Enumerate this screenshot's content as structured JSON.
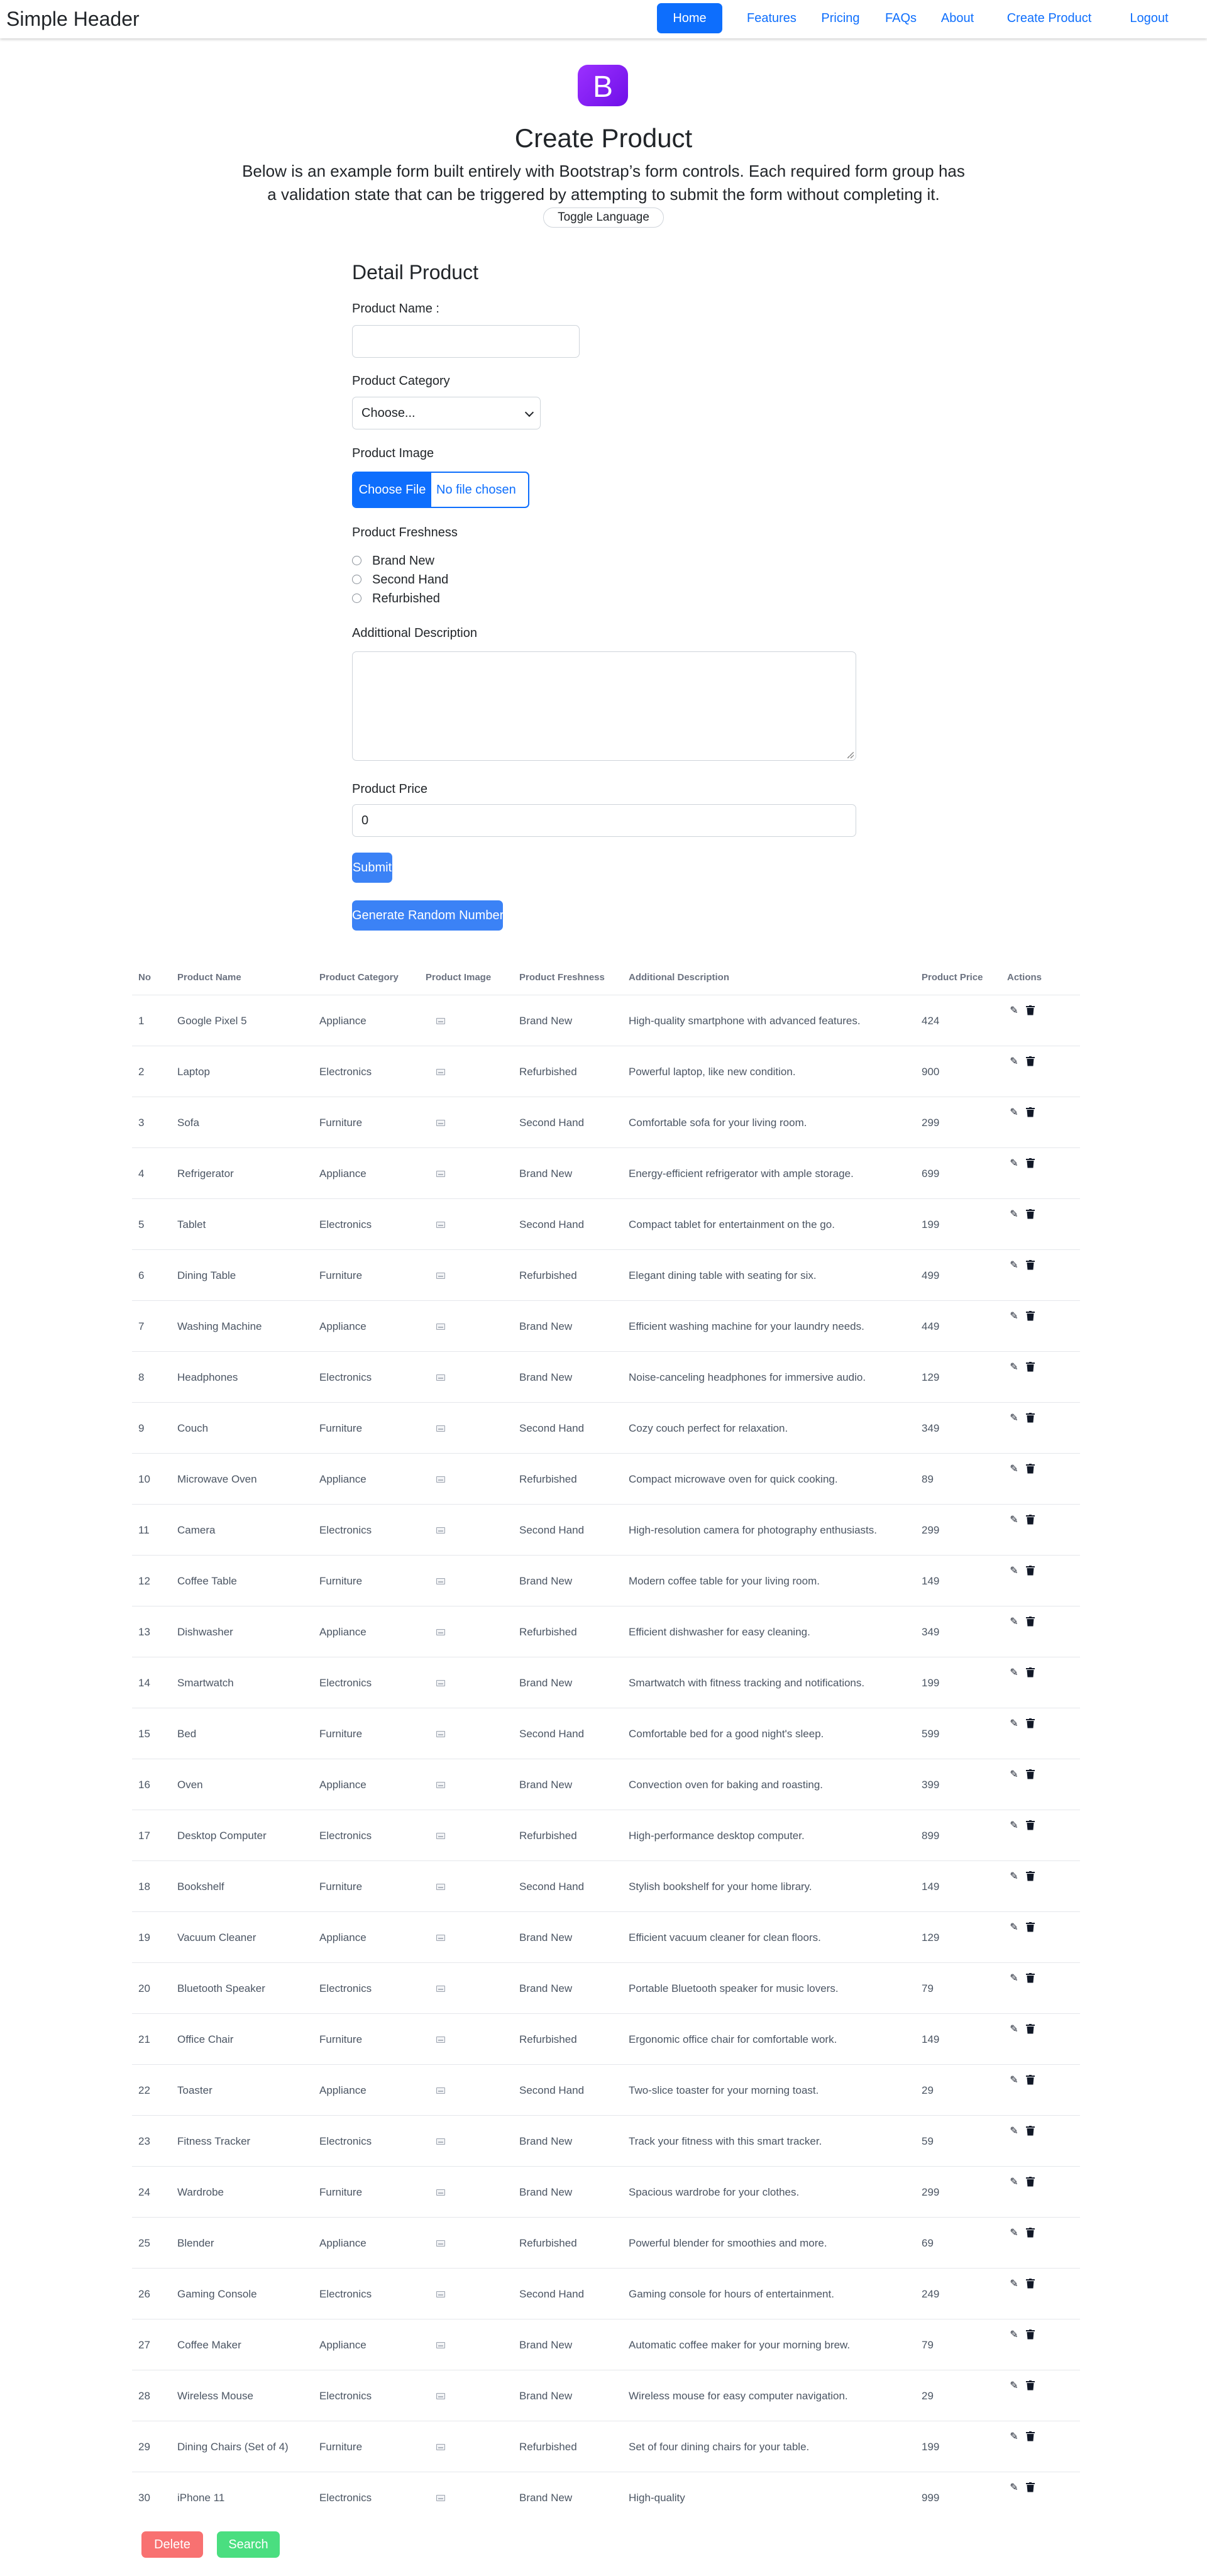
{
  "header": {
    "brand": "Simple Header",
    "nav": [
      "Home",
      "Features",
      "Pricing",
      "FAQs",
      "About",
      "Create Product",
      "Logout"
    ],
    "active": "Home"
  },
  "hero": {
    "logo_letter": "B",
    "title": "Create Product",
    "lead": "Below is an example form built entirely with Bootstrap’s form controls. Each required form group has a validation state that can be triggered by attempting to submit the form without completing it.",
    "toggle_label": "Toggle Language"
  },
  "form": {
    "title": "Detail Product",
    "name_label": "Product Name :",
    "name_value": "",
    "category_label": "Product Category",
    "category_selected": "Choose...",
    "image_label": "Product Image",
    "file_button": "Choose File",
    "file_status": "No file chosen",
    "freshness_label": "Product Freshness",
    "freshness_options": [
      "Brand New",
      "Second Hand",
      "Refurbished"
    ],
    "description_label": "Addittional Description",
    "price_label": "Product Price",
    "price_value": "0",
    "submit_label": "Submit",
    "random_label": "Generate Random Number"
  },
  "table": {
    "headers": [
      "No",
      "Product Name",
      "Product Category",
      "Product Image",
      "Product Freshness",
      "Additional Description",
      "Product Price",
      "Actions"
    ],
    "rows": [
      [
        "1",
        "Google Pixel 5",
        "Appliance",
        "Brand New",
        "High-quality smartphone with advanced features.",
        "424"
      ],
      [
        "2",
        "Laptop",
        "Electronics",
        "Refurbished",
        "Powerful laptop, like new condition.",
        "900"
      ],
      [
        "3",
        "Sofa",
        "Furniture",
        "Second Hand",
        "Comfortable sofa for your living room.",
        "299"
      ],
      [
        "4",
        "Refrigerator",
        "Appliance",
        "Brand New",
        "Energy-efficient refrigerator with ample storage.",
        "699"
      ],
      [
        "5",
        "Tablet",
        "Electronics",
        "Second Hand",
        "Compact tablet for entertainment on the go.",
        "199"
      ],
      [
        "6",
        "Dining Table",
        "Furniture",
        "Refurbished",
        "Elegant dining table with seating for six.",
        "499"
      ],
      [
        "7",
        "Washing Machine",
        "Appliance",
        "Brand New",
        "Efficient washing machine for your laundry needs.",
        "449"
      ],
      [
        "8",
        "Headphones",
        "Electronics",
        "Brand New",
        "Noise-canceling headphones for immersive audio.",
        "129"
      ],
      [
        "9",
        "Couch",
        "Furniture",
        "Second Hand",
        "Cozy couch perfect for relaxation.",
        "349"
      ],
      [
        "10",
        "Microwave Oven",
        "Appliance",
        "Refurbished",
        "Compact microwave oven for quick cooking.",
        "89"
      ],
      [
        "11",
        "Camera",
        "Electronics",
        "Second Hand",
        "High-resolution camera for photography enthusiasts.",
        "299"
      ],
      [
        "12",
        "Coffee Table",
        "Furniture",
        "Brand New",
        "Modern coffee table for your living room.",
        "149"
      ],
      [
        "13",
        "Dishwasher",
        "Appliance",
        "Refurbished",
        "Efficient dishwasher for easy cleaning.",
        "349"
      ],
      [
        "14",
        "Smartwatch",
        "Electronics",
        "Brand New",
        "Smartwatch with fitness tracking and notifications.",
        "199"
      ],
      [
        "15",
        "Bed",
        "Furniture",
        "Second Hand",
        "Comfortable bed for a good night's sleep.",
        "599"
      ],
      [
        "16",
        "Oven",
        "Appliance",
        "Brand New",
        "Convection oven for baking and roasting.",
        "399"
      ],
      [
        "17",
        "Desktop Computer",
        "Electronics",
        "Refurbished",
        "High-performance desktop computer.",
        "899"
      ],
      [
        "18",
        "Bookshelf",
        "Furniture",
        "Second Hand",
        "Stylish bookshelf for your home library.",
        "149"
      ],
      [
        "19",
        "Vacuum Cleaner",
        "Appliance",
        "Brand New",
        "Efficient vacuum cleaner for clean floors.",
        "129"
      ],
      [
        "20",
        "Bluetooth Speaker",
        "Electronics",
        "Brand New",
        "Portable Bluetooth speaker for music lovers.",
        "79"
      ],
      [
        "21",
        "Office Chair",
        "Furniture",
        "Refurbished",
        "Ergonomic office chair for comfortable work.",
        "149"
      ],
      [
        "22",
        "Toaster",
        "Appliance",
        "Second Hand",
        "Two-slice toaster for your morning toast.",
        "29"
      ],
      [
        "23",
        "Fitness Tracker",
        "Electronics",
        "Brand New",
        "Track your fitness with this smart tracker.",
        "59"
      ],
      [
        "24",
        "Wardrobe",
        "Furniture",
        "Brand New",
        "Spacious wardrobe for your clothes.",
        "299"
      ],
      [
        "25",
        "Blender",
        "Appliance",
        "Refurbished",
        "Powerful blender for smoothies and more.",
        "69"
      ],
      [
        "26",
        "Gaming Console",
        "Electronics",
        "Second Hand",
        "Gaming console for hours of entertainment.",
        "249"
      ],
      [
        "27",
        "Coffee Maker",
        "Appliance",
        "Brand New",
        "Automatic coffee maker for your morning brew.",
        "79"
      ],
      [
        "28",
        "Wireless Mouse",
        "Electronics",
        "Brand New",
        "Wireless mouse for easy computer navigation.",
        "29"
      ],
      [
        "29",
        "Dining Chairs (Set of 4)",
        "Furniture",
        "Refurbished",
        "Set of four dining chairs for your table.",
        "199"
      ],
      [
        "30",
        "iPhone 11",
        "Electronics",
        "Brand New",
        "High-quality",
        "999"
      ]
    ],
    "row_icons": [
      "image-placeholder-icon",
      "pencil-icon",
      "trash-icon"
    ]
  },
  "footer_buttons": {
    "delete_label": "Delete",
    "search_label": "Search"
  },
  "colors": {
    "primary": "#0d6efd",
    "button_blue": "#3b82f6",
    "delete_red": "#f87171",
    "search_green": "#4ade80",
    "logo_purple": "#7e22ce"
  }
}
